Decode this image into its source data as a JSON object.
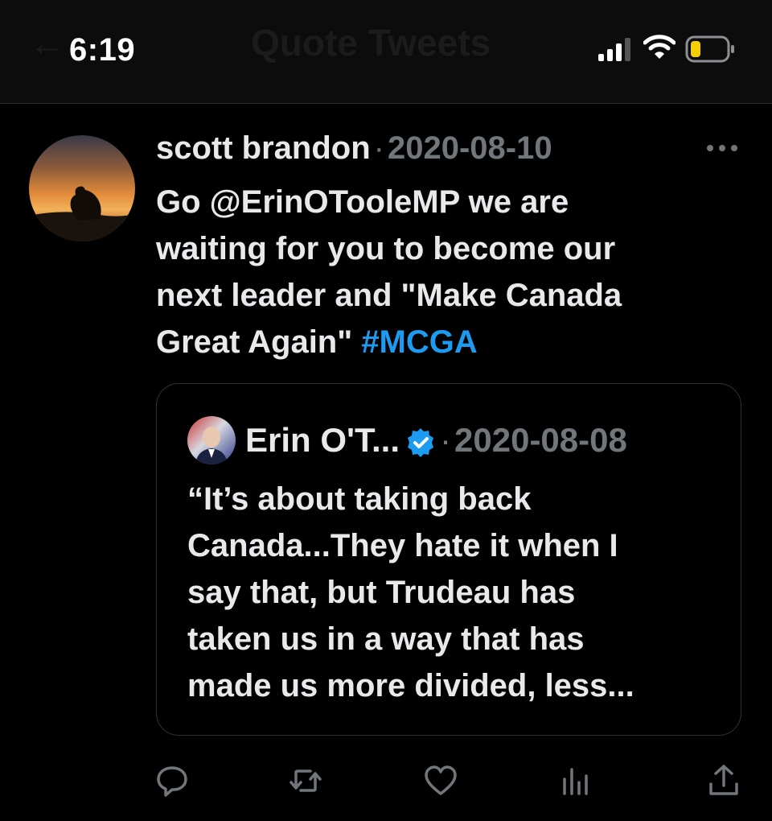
{
  "status_bar": {
    "time": "6:19",
    "background_title": "Quote Tweets",
    "background_back": "←"
  },
  "tweet": {
    "author": "scott brandon",
    "separator": "·",
    "date": "2020-08-10",
    "text_lines": [
      "Go @ErinOTooleMP we are",
      "waiting for you to become our",
      "next leader and \"Make Canada",
      "Great Again\" "
    ],
    "hashtag": "#MCGA"
  },
  "quoted_tweet": {
    "author": "Erin O'T...",
    "separator": "·",
    "date": "2020-08-08",
    "text_lines": [
      "“It’s about taking back",
      "Canada...They hate it when I",
      "say that, but Trudeau has",
      "taken us in a way that has",
      "made us more divided, less..."
    ]
  },
  "actions": {
    "icons": [
      "reply-icon",
      "retweet-icon",
      "like-icon",
      "views-icon",
      "share-icon"
    ]
  },
  "colors": {
    "background": "#000000",
    "text": "#e7e9ea",
    "muted": "#71767b",
    "accent": "#1d9bf0",
    "battery_level": "#f5d000"
  }
}
